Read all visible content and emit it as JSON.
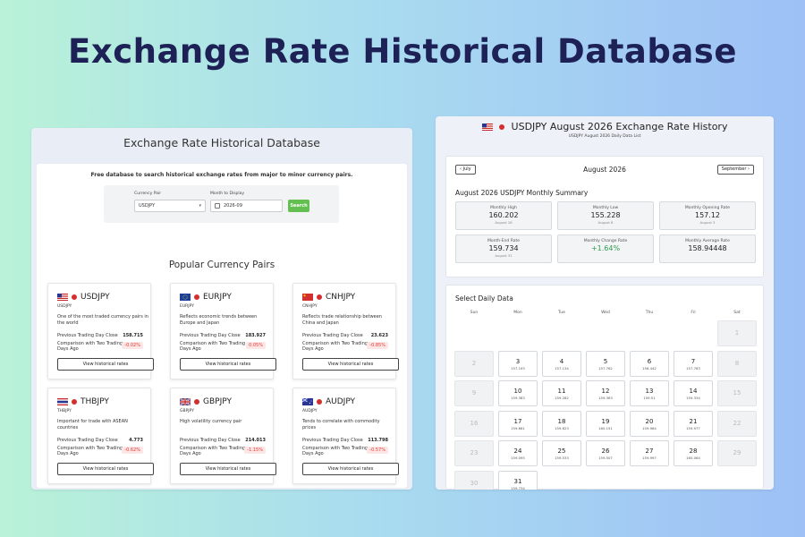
{
  "hero_title": "Exchange Rate Historical Database",
  "left": {
    "title": "Exchange Rate Historical Database",
    "intro": "Free database to search historical exchange rates from major to minor currency pairs.",
    "currency_pair_label": "Currency Pair",
    "currency_pair_value": "USDJPY",
    "month_label": "Month to Display",
    "month_value": "2026-09",
    "search_label": "Search",
    "popular_title": "Popular Currency Pairs",
    "cards": [
      {
        "flag": "US",
        "pair": "USDJPY",
        "code": "USDJPY",
        "desc": "One of the most traded currency pairs in the world",
        "prev_label": "Previous Trading Day Close",
        "prev_value": "158.715",
        "cmp_label": "Comparison with Two Trading Days Ago",
        "cmp_value": "-0.02%",
        "button": "View historical rates"
      },
      {
        "flag": "EU",
        "pair": "EURJPY",
        "code": "EURJPY",
        "desc": "Reflects economic trends between Europe and Japan",
        "prev_label": "Previous Trading Day Close",
        "prev_value": "183.927",
        "cmp_label": "Comparison with Two Trading Days Ago",
        "cmp_value": "0.05%",
        "button": "View historical rates"
      },
      {
        "flag": "CN",
        "pair": "CNHJPY",
        "code": "CNHJPY",
        "desc": "Reflects trade relationship between China and Japan",
        "prev_label": "Previous Trading Day Close",
        "prev_value": "23.623",
        "cmp_label": "Comparison with Two Trading Days Ago",
        "cmp_value": "-0.85%",
        "button": "View historical rates"
      },
      {
        "flag": "TH",
        "pair": "THBJPY",
        "code": "THBJPY",
        "desc": "Important for trade with ASEAN countries",
        "prev_label": "Previous Trading Day Close",
        "prev_value": "4.773",
        "cmp_label": "Comparison with Two Trading Days Ago",
        "cmp_value": "-0.62%",
        "button": "View historical rates"
      },
      {
        "flag": "GB",
        "pair": "GBPJPY",
        "code": "GBPJPY",
        "desc": "High volatility currency pair",
        "prev_label": "Previous Trading Day Close",
        "prev_value": "214.013",
        "cmp_label": "Comparison with Two Trading Days Ago",
        "cmp_value": "-1.15%",
        "button": "View historical rates"
      },
      {
        "flag": "AU",
        "pair": "AUDJPY",
        "code": "AUDJPY",
        "desc": "Tends to correlate with commodity prices",
        "prev_label": "Previous Trading Day Close",
        "prev_value": "113.798",
        "cmp_label": "Comparison with Two Trading Days Ago",
        "cmp_value": "-0.57%",
        "button": "View historical rates"
      }
    ]
  },
  "right": {
    "title": "USDJPY  August 2026 Exchange Rate History",
    "subtitle": "USDJPY  August 2026 Daily Data List",
    "prev_btn": "July",
    "next_btn": "September",
    "current_month": "August 2026",
    "summary_title": "August 2026 USDJPY Monthly Summary",
    "stats": [
      {
        "label": "Monthly High",
        "value": "160.202",
        "sub": "August 28",
        "color": "#222222"
      },
      {
        "label": "Monthly Low",
        "value": "155.228",
        "sub": "August 8",
        "color": "#222222"
      },
      {
        "label": "Monthly Opening Rate",
        "value": "157.12",
        "sub": "August 3",
        "color": "#222222"
      },
      {
        "label": "Month-End Rate",
        "value": "159.734",
        "sub": "August 31",
        "color": "#222222"
      },
      {
        "label": "Monthly Change Rate",
        "value": "+1.64%",
        "sub": "",
        "color": "#2e9d4f"
      },
      {
        "label": "Monthly Average Rate",
        "value": "158.94448",
        "sub": "",
        "color": "#222222"
      }
    ],
    "daily_title": "Select Daily Data",
    "weekdays": [
      "Sun",
      "Mon",
      "Tue",
      "Wed",
      "Thu",
      "Fri",
      "Sat"
    ],
    "days": [
      {
        "day": "1",
        "rate": "",
        "off": true
      },
      {
        "day": "2",
        "rate": "",
        "off": true
      },
      {
        "day": "3",
        "rate": "157.193",
        "off": false
      },
      {
        "day": "4",
        "rate": "157.134",
        "off": false
      },
      {
        "day": "5",
        "rate": "157.762",
        "off": false
      },
      {
        "day": "6",
        "rate": "156.442",
        "off": false
      },
      {
        "day": "7",
        "rate": "157.783",
        "off": false
      },
      {
        "day": "8",
        "rate": "",
        "off": true
      },
      {
        "day": "9",
        "rate": "",
        "off": true
      },
      {
        "day": "10",
        "rate": "159.383",
        "off": false
      },
      {
        "day": "11",
        "rate": "159.282",
        "off": false
      },
      {
        "day": "12",
        "rate": "159.363",
        "off": false
      },
      {
        "day": "13",
        "rate": "159.51",
        "off": false
      },
      {
        "day": "14",
        "rate": "159.334",
        "off": false
      },
      {
        "day": "15",
        "rate": "",
        "off": true
      },
      {
        "day": "16",
        "rate": "",
        "off": true
      },
      {
        "day": "17",
        "rate": "159.661",
        "off": false
      },
      {
        "day": "18",
        "rate": "159.623",
        "off": false
      },
      {
        "day": "19",
        "rate": "160.151",
        "off": false
      },
      {
        "day": "20",
        "rate": "159.964",
        "off": false
      },
      {
        "day": "21",
        "rate": "159.977",
        "off": false
      },
      {
        "day": "22",
        "rate": "",
        "off": true
      },
      {
        "day": "23",
        "rate": "",
        "off": true
      },
      {
        "day": "24",
        "rate": "159.095",
        "off": false
      },
      {
        "day": "25",
        "rate": "159.533",
        "off": false
      },
      {
        "day": "26",
        "rate": "159.507",
        "off": false
      },
      {
        "day": "27",
        "rate": "159.997",
        "off": false
      },
      {
        "day": "28",
        "rate": "160.064",
        "off": false
      },
      {
        "day": "29",
        "rate": "",
        "off": true
      },
      {
        "day": "30",
        "rate": "",
        "off": true
      },
      {
        "day": "31",
        "rate": "159.734",
        "off": false
      }
    ]
  }
}
